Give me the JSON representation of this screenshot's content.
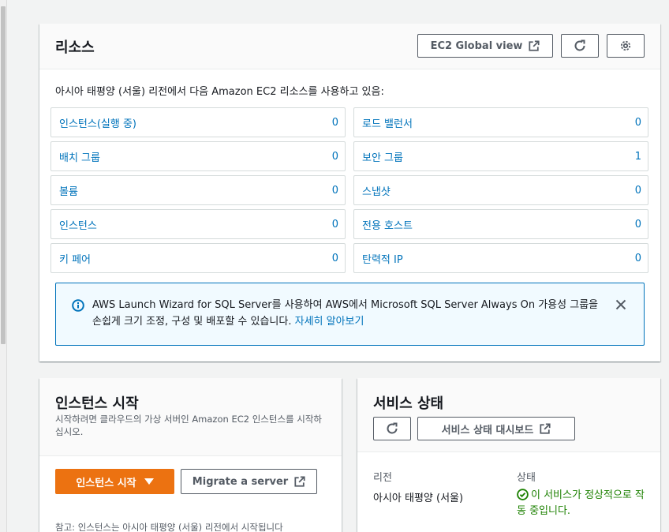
{
  "resources": {
    "title": "리소스",
    "global_view_label": "EC2 Global view",
    "intro": "아시아 태평양 (서울) 리전에서 다음 Amazon EC2 리소스를 사용하고 있음:",
    "items": [
      {
        "label": "인스턴스(실행 중)",
        "count": "0"
      },
      {
        "label": "로드 밸런서",
        "count": "0"
      },
      {
        "label": "배치 그룹",
        "count": "0"
      },
      {
        "label": "보안 그룹",
        "count": "1"
      },
      {
        "label": "볼륨",
        "count": "0"
      },
      {
        "label": "스냅샷",
        "count": "0"
      },
      {
        "label": "인스턴스",
        "count": "0"
      },
      {
        "label": "전용 호스트",
        "count": "0"
      },
      {
        "label": "키 페어",
        "count": "0"
      },
      {
        "label": "탄력적 IP",
        "count": "0"
      }
    ],
    "alert": {
      "text": "AWS Launch Wizard for SQL Server를 사용하여 AWS에서 Microsoft SQL Server Always On 가용성 그룹을 손쉽게 크기 조정, 구성 및 배포할 수 있습니다. ",
      "link": "자세히 알아보기"
    }
  },
  "launch": {
    "title": "인스턴스 시작",
    "description": "시작하려면 클라우드의 가상 서버인 Amazon EC2 인스턴스를 시작하십시오.",
    "launch_button": "인스턴스 시작",
    "migrate_button": "Migrate a server",
    "note": "참고: 인스턴스는 아시아 태평양 (서울) 리전에서 시작됩니다"
  },
  "health": {
    "title": "서비스 상태",
    "dashboard_button": "서비스 상태 대시보드",
    "region_header": "리전",
    "status_header": "상태",
    "region_value": "아시아 태평양 (서울)",
    "status_value": "이 서비스가 정상적으로 작동 중입니다."
  },
  "colors": {
    "link": "#0073bb",
    "primary": "#ec7211",
    "success": "#1d8102",
    "info": "#0073bb"
  }
}
